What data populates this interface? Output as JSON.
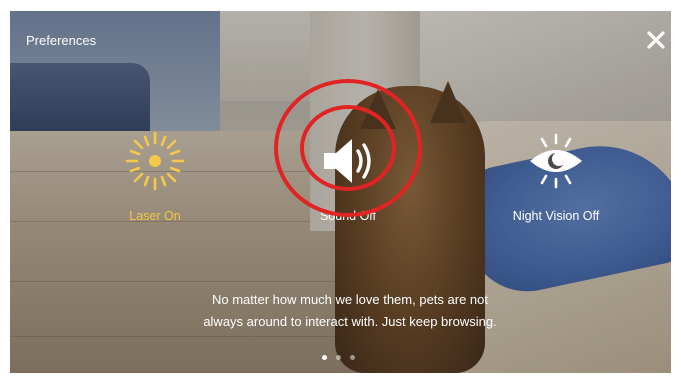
{
  "header": {
    "title": "Preferences",
    "close_icon": "close-icon"
  },
  "options": [
    {
      "label": "Laser On",
      "icon": "laser-sun-icon",
      "color": "#f4c84a"
    },
    {
      "label": "Sound Off",
      "icon": "speaker-icon",
      "color": "#ffffff"
    },
    {
      "label": "Night Vision Off",
      "icon": "eye-icon",
      "color": "#ffffff"
    }
  ],
  "highlight_color": "#e02424",
  "caption": {
    "line1": "No matter how much we love them, pets are not",
    "line2": "always around to interact with. Just keep browsing."
  },
  "pager": {
    "count": 3,
    "active_index": 0
  }
}
